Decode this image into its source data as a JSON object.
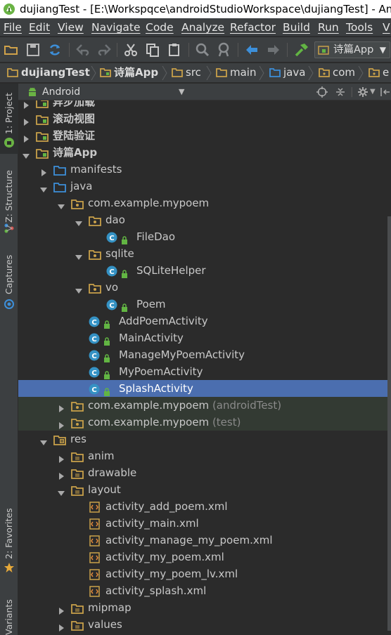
{
  "window": {
    "title": "dujiangTest - [E:\\Workspqce\\androidStudioWorkspace\\dujiangTest] - Android Studio"
  },
  "menu": [
    {
      "label": "File"
    },
    {
      "label": "Edit"
    },
    {
      "label": "View"
    },
    {
      "label": "Navigate"
    },
    {
      "label": "Code"
    },
    {
      "label": "Analyze"
    },
    {
      "label": "Refactor"
    },
    {
      "label": "Build"
    },
    {
      "label": "Run"
    },
    {
      "label": "Tools"
    },
    {
      "label": "V"
    }
  ],
  "toolbar": {
    "run_config": "诗篇App",
    "icons": [
      "open-folder-icon",
      "save-icon",
      "sync-icon",
      "undo-icon",
      "redo-icon",
      "cut-icon",
      "copy-icon",
      "paste-icon",
      "find-icon",
      "find-replace-icon",
      "back-icon",
      "forward-icon",
      "build-hammer-icon"
    ]
  },
  "breadcrumb": [
    {
      "label": "dujiangTest",
      "bold": true
    },
    {
      "label": "诗篇App",
      "bold": true
    },
    {
      "label": "src"
    },
    {
      "label": "main"
    },
    {
      "label": "java"
    },
    {
      "label": "com"
    },
    {
      "label": "e"
    }
  ],
  "side_tabs": [
    {
      "label": "1: Project"
    },
    {
      "label": "Z: Structure"
    },
    {
      "label": "Captures"
    },
    {
      "label": "2: Favorites"
    },
    {
      "label": "Variants"
    }
  ],
  "project_panel": {
    "view_mode": "Android"
  },
  "tree": [
    {
      "label": "异步加载",
      "suffix": "",
      "kind": "module",
      "indent": 0,
      "arrow": "right",
      "bold": true
    },
    {
      "label": "滚动视图",
      "suffix": "",
      "kind": "module",
      "indent": 0,
      "arrow": "right",
      "bold": true
    },
    {
      "label": "登陆验证",
      "suffix": "",
      "kind": "module",
      "indent": 0,
      "arrow": "right",
      "bold": true
    },
    {
      "label": "诗篇App",
      "suffix": "",
      "kind": "module",
      "indent": 0,
      "arrow": "down",
      "bold": true
    },
    {
      "label": "manifests",
      "suffix": "",
      "kind": "folder-blue",
      "indent": 1,
      "arrow": "right"
    },
    {
      "label": "java",
      "suffix": "",
      "kind": "folder-blue",
      "indent": 1,
      "arrow": "down"
    },
    {
      "label": "com.example.mypoem",
      "suffix": "",
      "kind": "package",
      "indent": 2,
      "arrow": "down"
    },
    {
      "label": "dao",
      "suffix": "",
      "kind": "package",
      "indent": 3,
      "arrow": "down"
    },
    {
      "label": "FileDao",
      "suffix": "",
      "kind": "class",
      "indent": 4,
      "arrow": "none"
    },
    {
      "label": "sqlite",
      "suffix": "",
      "kind": "package",
      "indent": 3,
      "arrow": "down"
    },
    {
      "label": "SQLiteHelper",
      "suffix": "",
      "kind": "class",
      "indent": 4,
      "arrow": "none"
    },
    {
      "label": "vo",
      "suffix": "",
      "kind": "package",
      "indent": 3,
      "arrow": "down"
    },
    {
      "label": "Poem",
      "suffix": "",
      "kind": "class",
      "indent": 4,
      "arrow": "none"
    },
    {
      "label": "AddPoemActivity",
      "suffix": "",
      "kind": "class",
      "indent": 3,
      "arrow": "none"
    },
    {
      "label": "MainActivity",
      "suffix": "",
      "kind": "class",
      "indent": 3,
      "arrow": "none"
    },
    {
      "label": "ManageMyPoemActivity",
      "suffix": "",
      "kind": "class",
      "indent": 3,
      "arrow": "none"
    },
    {
      "label": "MyPoemActivity",
      "suffix": "",
      "kind": "class",
      "indent": 3,
      "arrow": "none"
    },
    {
      "label": "SplashActivity",
      "suffix": "",
      "kind": "class",
      "indent": 3,
      "arrow": "none",
      "selected": true
    },
    {
      "label": "com.example.mypoem",
      "suffix": " (androidTest)",
      "kind": "package",
      "indent": 2,
      "arrow": "right",
      "shaded": true
    },
    {
      "label": "com.example.mypoem",
      "suffix": " (test)",
      "kind": "package",
      "indent": 2,
      "arrow": "right",
      "shaded": true
    },
    {
      "label": "res",
      "suffix": "",
      "kind": "res",
      "indent": 1,
      "arrow": "down"
    },
    {
      "label": "anim",
      "suffix": "",
      "kind": "folder",
      "indent": 2,
      "arrow": "right"
    },
    {
      "label": "drawable",
      "suffix": "",
      "kind": "folder",
      "indent": 2,
      "arrow": "right"
    },
    {
      "label": "layout",
      "suffix": "",
      "kind": "folder",
      "indent": 2,
      "arrow": "down"
    },
    {
      "label": "activity_add_poem.xml",
      "suffix": "",
      "kind": "xml",
      "indent": 3,
      "arrow": "none"
    },
    {
      "label": "activity_main.xml",
      "suffix": "",
      "kind": "xml",
      "indent": 3,
      "arrow": "none"
    },
    {
      "label": "activity_manage_my_poem.xml",
      "suffix": "",
      "kind": "xml",
      "indent": 3,
      "arrow": "none"
    },
    {
      "label": "activity_my_poem.xml",
      "suffix": "",
      "kind": "xml",
      "indent": 3,
      "arrow": "none"
    },
    {
      "label": "activity_my_poem_lv.xml",
      "suffix": "",
      "kind": "xml",
      "indent": 3,
      "arrow": "none"
    },
    {
      "label": "activity_splash.xml",
      "suffix": "",
      "kind": "xml",
      "indent": 3,
      "arrow": "none"
    },
    {
      "label": "mipmap",
      "suffix": "",
      "kind": "folder",
      "indent": 2,
      "arrow": "right"
    },
    {
      "label": "values",
      "suffix": "",
      "kind": "folder",
      "indent": 2,
      "arrow": "right"
    }
  ],
  "colors": {
    "background": "#2b2b2b",
    "chrome": "#3c3f41",
    "selection": "#4b6eaf",
    "folder": "#c9a14a",
    "class_icon": "#3592c4",
    "lock": "#62b543"
  }
}
